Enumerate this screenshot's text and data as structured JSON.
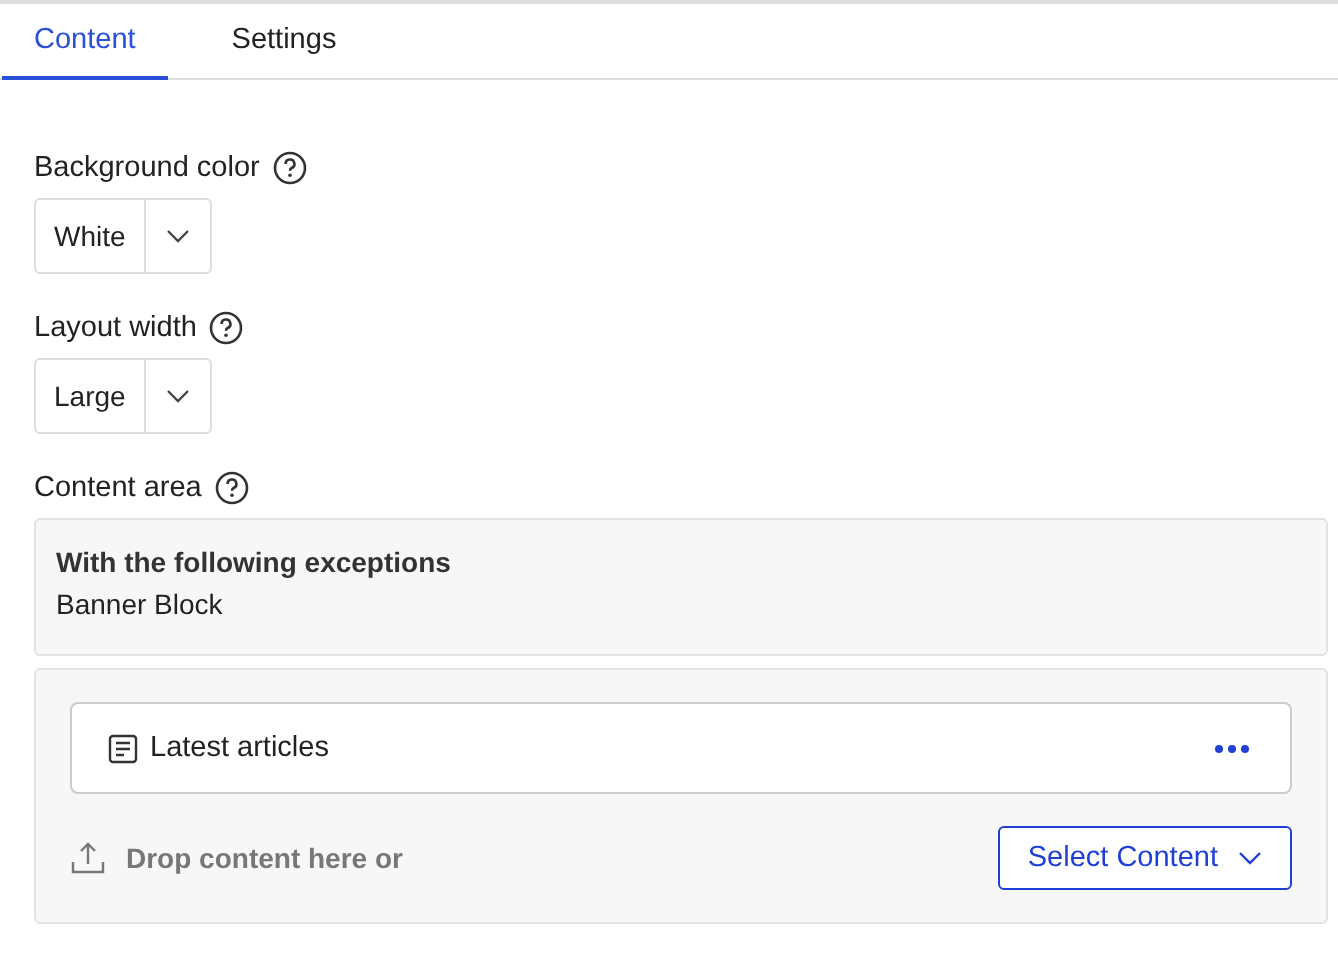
{
  "tabs": [
    {
      "label": "Content",
      "selected": true
    },
    {
      "label": "Settings",
      "selected": false
    }
  ],
  "fields": [
    {
      "label": "Background color",
      "value": "White"
    },
    {
      "label": "Layout width",
      "value": "Large"
    }
  ],
  "content_area": {
    "label": "Content area",
    "exceptions_title": "With the following exceptions",
    "exceptions": [
      "Banner Block"
    ],
    "items": [
      {
        "title": "Latest articles"
      }
    ],
    "drop_hint": "Drop content here or",
    "select_button": "Select Content"
  }
}
